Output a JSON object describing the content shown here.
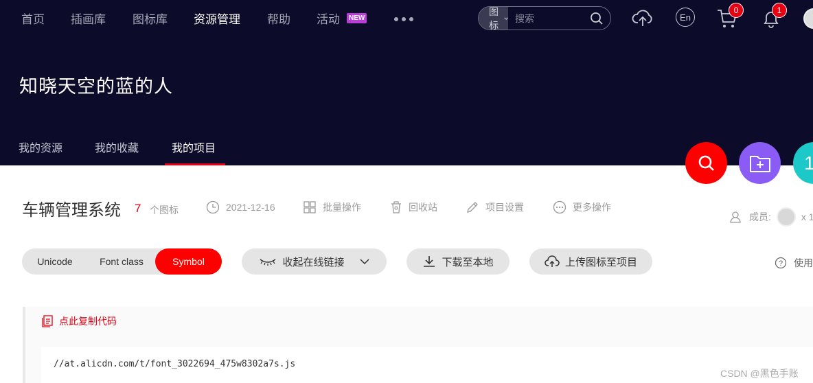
{
  "nav": {
    "items": [
      {
        "label": "首页",
        "active": false
      },
      {
        "label": "插画库",
        "active": false
      },
      {
        "label": "图标库",
        "active": false
      },
      {
        "label": "资源管理",
        "active": true
      },
      {
        "label": "帮助",
        "active": false
      },
      {
        "label": "活动",
        "active": false
      }
    ],
    "new_badge": "NEW",
    "more_icon": "more-dots-icon",
    "search": {
      "type_label": "图标",
      "placeholder": "搜索"
    },
    "lang_label": "En",
    "cart_count": "0",
    "notification_count": "1"
  },
  "site_title": "知晓天空的蓝的人",
  "subnav": {
    "items": [
      "我的资源",
      "我的收藏",
      "我的项目"
    ],
    "active_index": 2
  },
  "fab": {
    "third_label": "1"
  },
  "project": {
    "name": "车辆管理系统",
    "icon_count": "7",
    "icon_count_unit": "个图标",
    "date": "2021-12-16",
    "batch_label": "批量操作",
    "recycle_label": "回收站",
    "settings_label": "项目设置",
    "more_label": "更多操作",
    "members_label": "成员:",
    "members_extra": "x 1"
  },
  "toolbar": {
    "modes": [
      "Unicode",
      "Font class",
      "Symbol"
    ],
    "active_mode": 2,
    "collapse_label": "收起在线链接",
    "download_label": "下载至本地",
    "upload_label": "上传图标至项目",
    "help_label": "使用帮助"
  },
  "code": {
    "copy_label": "点此复制代码",
    "url": "//at.alicdn.com/t/font_3022694_475w8302a7s.js"
  },
  "watermark": "CSDN @黑色手账",
  "colors": {
    "accent": "#e60012",
    "header_bg": "#0c0b2a",
    "purple": "#8a5cf5",
    "teal": "#1cc8c8"
  }
}
